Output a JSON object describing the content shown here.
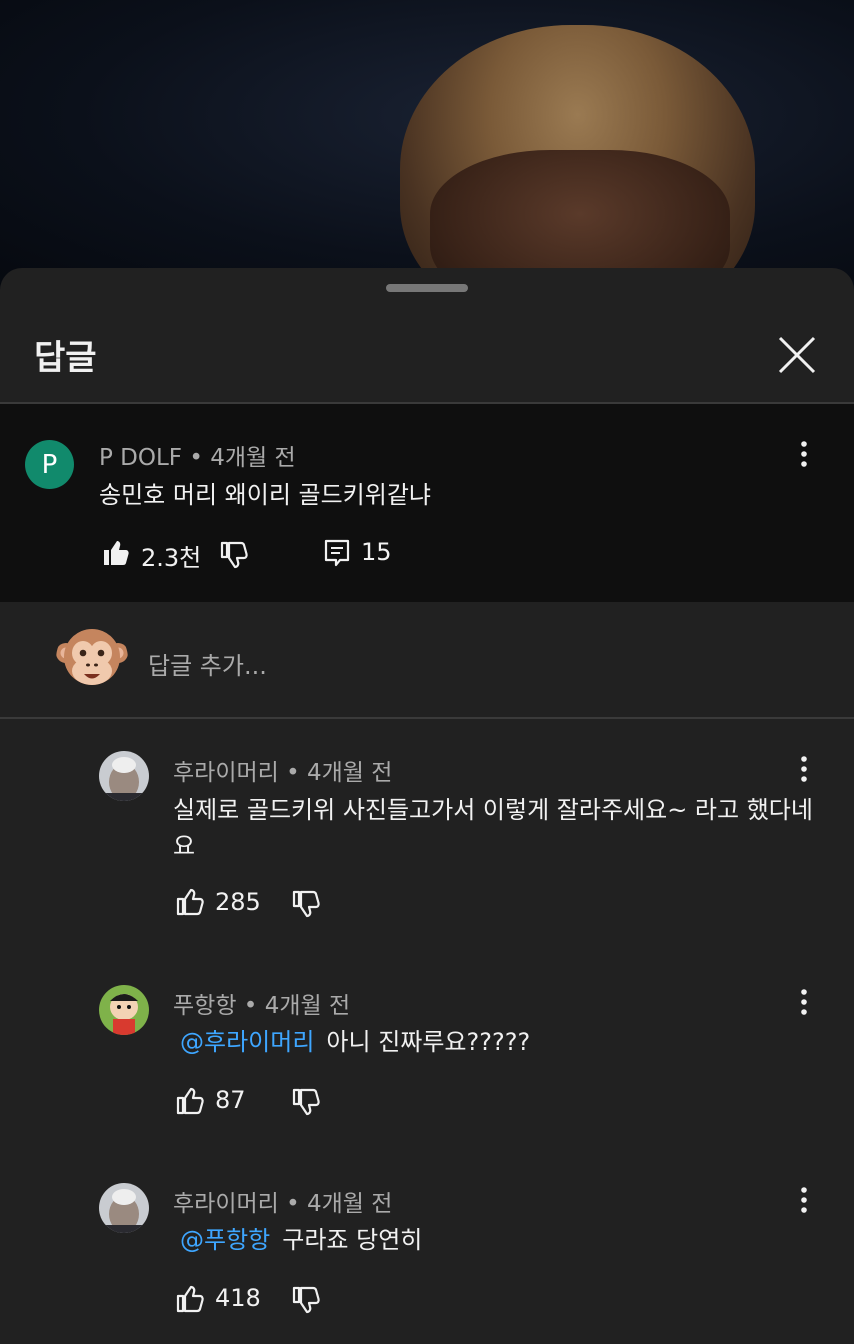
{
  "sheet": {
    "title": "답글",
    "add_reply_placeholder": "답글 추가..."
  },
  "parent_comment": {
    "author": "P DOLF",
    "avatar_letter": "P",
    "time": "4개월 전",
    "text": "송민호 머리 왜이리 골드키위같냐",
    "likes": "2.3천",
    "replies": "15"
  },
  "replies": [
    {
      "author": "후라이머리",
      "time": "4개월 전",
      "text_line1": "실제로 골드키위 사진들고가서 이렇게 잘라주세요~ 라고 했다네",
      "text_line2": "요",
      "likes": "285"
    },
    {
      "author": "푸항항",
      "time": "4개월 전",
      "mention": "@후라이머리",
      "text": "아니 진짜루요?????",
      "likes": "87"
    },
    {
      "author": "후라이머리",
      "time": "4개월 전",
      "mention": "@푸항항",
      "text": "구라죠 당연히",
      "likes": "418"
    }
  ],
  "meta_separator": " • ",
  "icons": {
    "close": "close-icon",
    "more": "more-vert-icon",
    "like": "thumb-up-icon",
    "dislike": "thumb-down-icon",
    "reply": "comment-icon"
  }
}
